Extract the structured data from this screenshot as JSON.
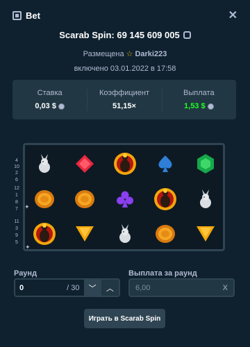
{
  "header": {
    "title": "Bet",
    "close_icon": "close-icon"
  },
  "game_line": {
    "text": "Scarab Spin: 69 145 609 005"
  },
  "placed": {
    "label": "Размещена",
    "user": "Darki223"
  },
  "date": {
    "text": "включено 03.01.2022 в 17:58"
  },
  "stats": {
    "stake_label": "Ставка",
    "stake_value": "0,03 $",
    "coef_label": "Коэффициент",
    "coef_value": "51,15×",
    "payout_label": "Выплата",
    "payout_value": "1,53 $"
  },
  "paylines": {
    "left": [
      "4",
      "10",
      "2",
      "6",
      "12",
      "1",
      "8",
      "7",
      "11",
      "3",
      "9",
      "5"
    ],
    "right": [
      "10",
      "2",
      "6",
      "12",
      "1",
      "8",
      "7",
      "11",
      "3",
      "9",
      "5"
    ]
  },
  "board": {
    "rows": [
      [
        "hare-icon",
        "red-gem-icon",
        "scarab-icon",
        "blue-spade-icon",
        "green-gem-icon"
      ],
      [
        "coin-icon",
        "coin-icon",
        "purple-club-icon",
        "scarab-icon",
        "hare-icon"
      ],
      [
        "scarab-icon",
        "yellow-triangle-icon",
        "hare-icon",
        "coin-icon",
        "yellow-triangle-icon"
      ]
    ]
  },
  "round": {
    "label": "Раунд",
    "value": "0",
    "max": "/ 30"
  },
  "payout_round": {
    "label": "Выплата за раунд",
    "value": "6,00",
    "clear": "X"
  },
  "play_button": {
    "label": "Играть в Scarab Spin"
  },
  "colors": {
    "bg": "#0f212e",
    "panel": "#213743",
    "border": "#2f4553",
    "green": "#1fff20",
    "muted": "#b1bad3"
  }
}
